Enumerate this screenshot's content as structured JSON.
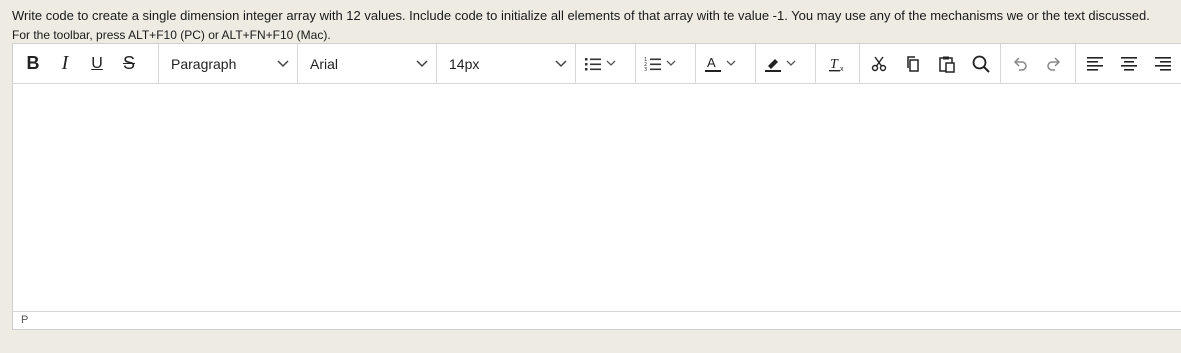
{
  "question": {
    "text": "Write code to create a single dimension integer array with 12 values.  Include code to initialize all elements of that array with te value -1.  You may use any of the mechanisms we or the text discussed."
  },
  "toolbar_hint": "For the toolbar, press ALT+F10 (PC) or ALT+FN+F10 (Mac).",
  "toolbar": {
    "bold": "B",
    "italic": "I",
    "underline": "U",
    "strikethrough": "S",
    "block_format": "Paragraph",
    "font_family": "Arial",
    "font_size": "14px"
  },
  "editor": {
    "content": "",
    "status_path": "P"
  },
  "colors": {
    "page_bg": "#edebe2",
    "editor_bg": "#ffffff",
    "border": "#cfcfcf"
  }
}
